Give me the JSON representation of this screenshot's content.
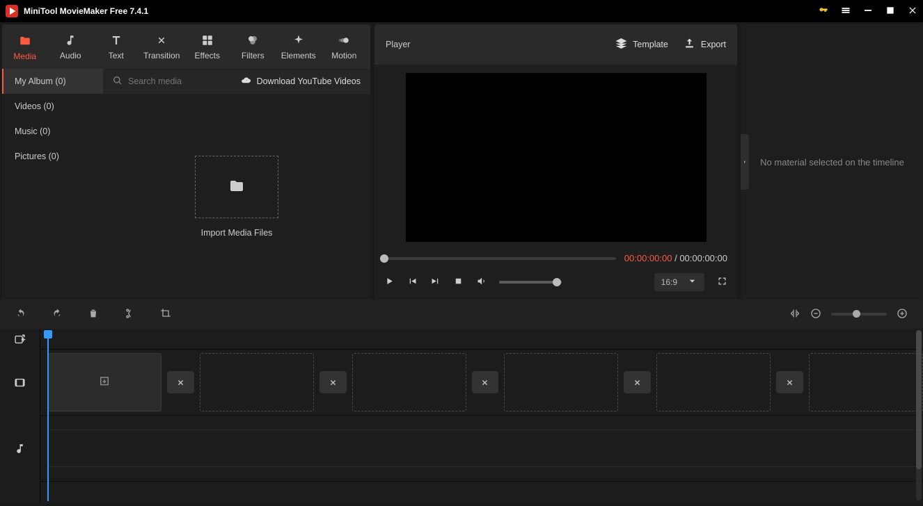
{
  "title": "MiniTool MovieMaker Free 7.4.1",
  "topTabs": [
    {
      "label": "Media"
    },
    {
      "label": "Audio"
    },
    {
      "label": "Text"
    },
    {
      "label": "Transition"
    },
    {
      "label": "Effects"
    },
    {
      "label": "Filters"
    },
    {
      "label": "Elements"
    },
    {
      "label": "Motion"
    }
  ],
  "sideCats": [
    {
      "label": "My Album (0)"
    },
    {
      "label": "Videos (0)"
    },
    {
      "label": "Music (0)"
    },
    {
      "label": "Pictures (0)"
    }
  ],
  "search": {
    "placeholder": "Search media"
  },
  "downloadLink": "Download YouTube Videos",
  "importLabel": "Import Media Files",
  "player": {
    "title": "Player",
    "templateBtn": "Template",
    "exportBtn": "Export",
    "currentTime": "00:00:00:00",
    "sep": " / ",
    "totalTime": "00:00:00:00",
    "aspectRatio": "16:9"
  },
  "inspector": {
    "empty": "No material selected on the timeline"
  }
}
